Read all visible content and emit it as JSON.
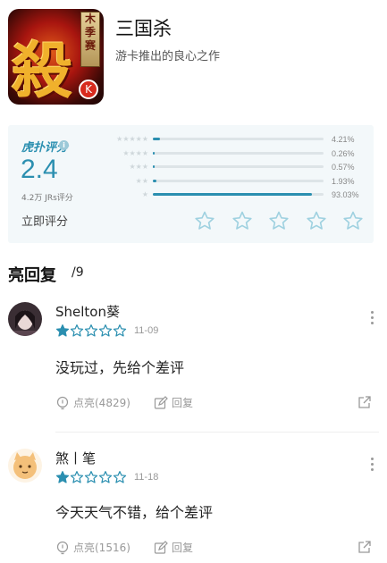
{
  "app": {
    "title": "三国杀",
    "subtitle": "游卡推出的良心之作",
    "icon_glyph": "殺",
    "icon_scroll_text": [
      "木",
      "季",
      "赛"
    ],
    "icon_badge": "K"
  },
  "rating": {
    "label": "虎扑评分",
    "info_icon": "info-icon",
    "score": "2.4",
    "count": "4.2万 JRs评分",
    "rate_now": "立即评分",
    "accent_color": "#2b8fb0",
    "distribution": [
      {
        "stars": "★★★★★",
        "fraction": 0.0421,
        "percent": "4.21%"
      },
      {
        "stars": "★★★★",
        "fraction": 0.0026,
        "percent": "0.26%"
      },
      {
        "stars": "★★★",
        "fraction": 0.0057,
        "percent": "0.57%"
      },
      {
        "stars": "★★",
        "fraction": 0.0193,
        "percent": "1.93%"
      },
      {
        "stars": "★",
        "fraction": 0.9303,
        "percent": "93.03%"
      }
    ]
  },
  "section": {
    "title": "亮回复",
    "count": "/9"
  },
  "comments": [
    {
      "username": "Shelton葵",
      "rating": 1,
      "date": "11-09",
      "content": "没玩过，先给个差评",
      "like_label": "点亮(4829)",
      "reply_label": "回复"
    },
    {
      "username": "煞丨笔",
      "rating": 1,
      "date": "11-18",
      "content": "今天天气不错，给个差评",
      "like_label": "点亮(1516)",
      "reply_label": "回复"
    }
  ]
}
